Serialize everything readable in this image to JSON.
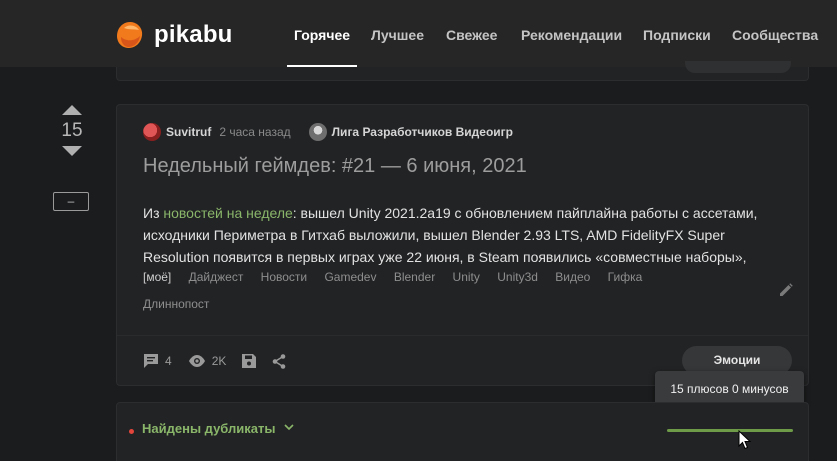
{
  "header": {
    "logo_text": "pikabu",
    "nav": [
      {
        "label": "Горячее",
        "active": true
      },
      {
        "label": "Лучшее",
        "active": false
      },
      {
        "label": "Свежее",
        "active": false
      },
      {
        "label": "Рекомендации",
        "active": false
      },
      {
        "label": "Подписки",
        "active": false
      },
      {
        "label": "Сообщества",
        "active": false
      }
    ]
  },
  "vote": {
    "rating": "15",
    "minus_label": "–"
  },
  "story": {
    "author": "Suvitruf",
    "time": "2 часа назад",
    "community": "Лига Разработчиков Видеоигр",
    "title": "Недельный геймдев: #21 — 6 июня, 2021",
    "text_prefix": "Из ",
    "text_link": "новостей на неделе",
    "text_body": ": вышел Unity 2021.2a19 с обновлением пайплайна работы с ассетами, исходники Периметра в Гитхаб выложили, вышел Blender 2.93 LTS, AMD FidelityFX Super Resolution появится в первых играх уже 22 июня, в Steam появились «совместные наборы»,",
    "tags": [
      "[моё]",
      "Дайджест",
      "Новости",
      "Gamedev",
      "Blender",
      "Unity",
      "Unity3d",
      "Видео",
      "Гифка",
      "Длиннопост"
    ],
    "comments_count": "4",
    "views_count": "2K",
    "emotions_label": "Эмоции"
  },
  "tooltip": {
    "text": "15 плюсов 0 минусов"
  },
  "duplicates": {
    "label": "Найдены дубликаты",
    "plus_share": 1.0
  },
  "colors": {
    "accent_green": "#8ab66a",
    "header_bg": "#262626",
    "page_bg": "#1b1c1e",
    "card_bg": "#222325"
  },
  "icons": [
    "pikabu-logo-icon",
    "comments-icon",
    "eye-icon",
    "save-icon",
    "share-icon",
    "pencil-icon",
    "chevron-down-icon",
    "arrow-up-icon",
    "arrow-down-icon",
    "mouse-cursor-icon"
  ]
}
